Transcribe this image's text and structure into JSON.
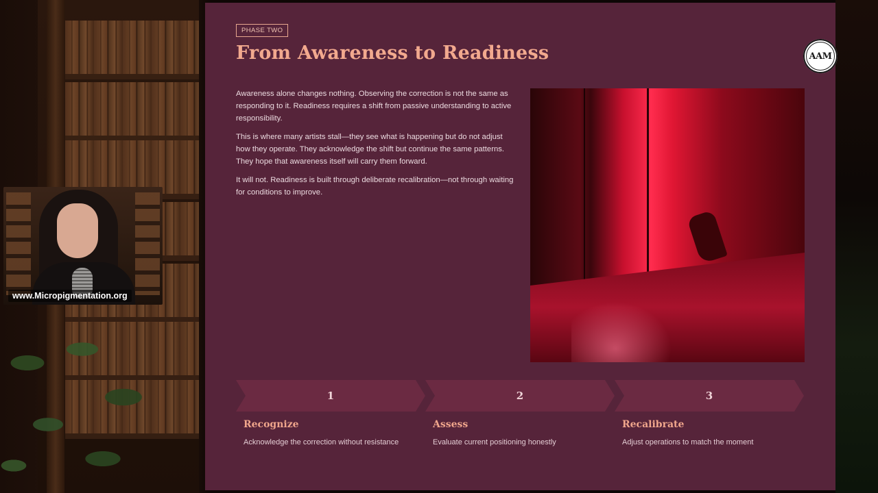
{
  "webcam": {
    "url_overlay": "www.Micropigmentation.org"
  },
  "slide": {
    "phase_label": "PHASE TWO",
    "title": "From Awareness to Readiness",
    "logo_text": "AAM",
    "paragraphs": [
      "Awareness alone changes nothing. Observing the correction is not the same as responding to it. Readiness requires a shift from passive understanding to active responsibility.",
      "This is where many artists stall—they see what is happening but do not adjust how they operate. They acknowledge the shift but continue the same patterns. They hope that awareness itself will carry them forward.",
      "It will not. Readiness is built through deliberate recalibration—not through waiting for conditions to improve."
    ],
    "steps": [
      {
        "number": "1",
        "title": "Recognize",
        "description": "Acknowledge the correction without resistance"
      },
      {
        "number": "2",
        "title": "Assess",
        "description": "Evaluate current positioning honestly"
      },
      {
        "number": "3",
        "title": "Recalibrate",
        "description": "Adjust operations to match the moment"
      }
    ]
  },
  "colors": {
    "slide_bg": "#56243a",
    "accent": "#f2a98e",
    "step_bg": "#6b2a42"
  }
}
